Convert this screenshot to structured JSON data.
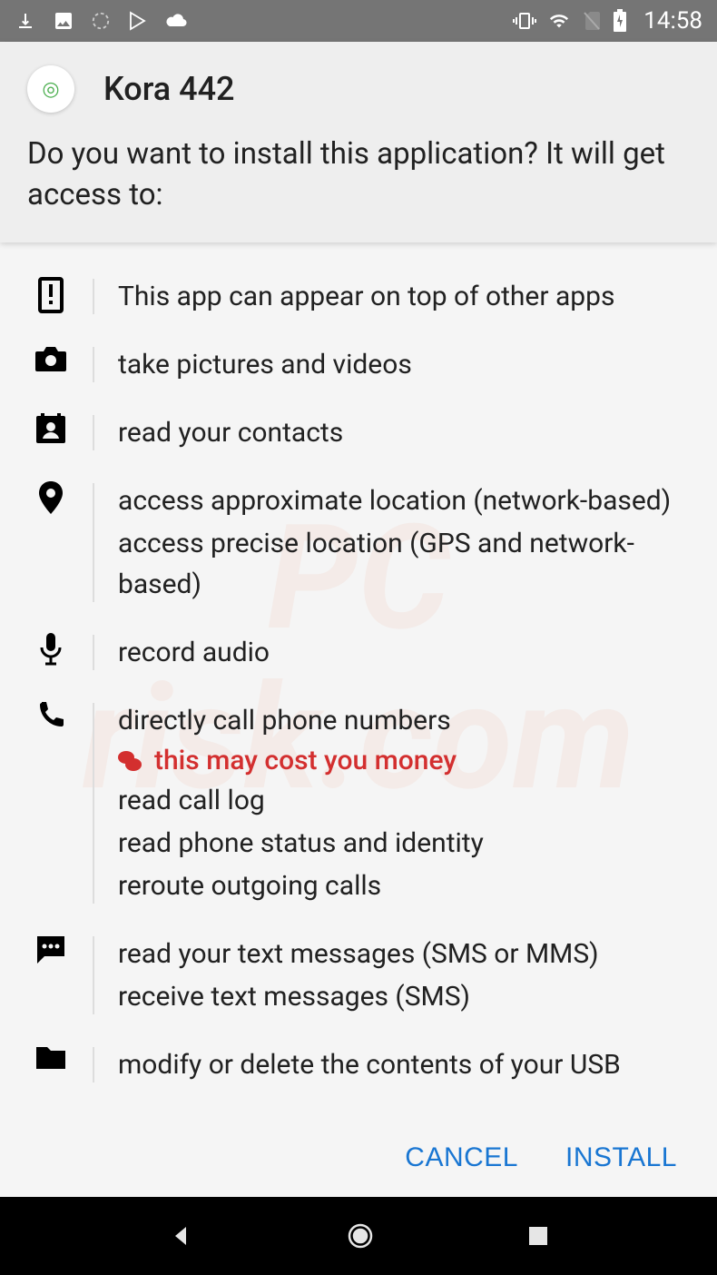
{
  "status": {
    "time": "14:58"
  },
  "header": {
    "app_name": "Kora 442",
    "prompt": "Do you want to install this application? It will get access to:"
  },
  "permissions": [
    {
      "icon": "overlay",
      "lines": [
        "This app can appear on top of other apps"
      ]
    },
    {
      "icon": "camera",
      "lines": [
        "take pictures and videos"
      ]
    },
    {
      "icon": "contacts",
      "lines": [
        "read your contacts"
      ]
    },
    {
      "icon": "location",
      "lines": [
        "access approximate location (network-based)",
        "access precise location (GPS and network-based)"
      ]
    },
    {
      "icon": "mic",
      "lines": [
        "record audio"
      ]
    },
    {
      "icon": "phone",
      "lines": [
        "directly call phone numbers"
      ],
      "warning": "this may cost you money",
      "more": [
        "read call log",
        "read phone status and identity",
        "reroute outgoing calls"
      ]
    },
    {
      "icon": "sms",
      "lines": [
        "read your text messages (SMS or MMS)",
        "receive text messages (SMS)"
      ]
    },
    {
      "icon": "storage",
      "lines": [
        "modify or delete the contents of your USB"
      ]
    }
  ],
  "buttons": {
    "cancel": "CANCEL",
    "install": "INSTALL"
  }
}
